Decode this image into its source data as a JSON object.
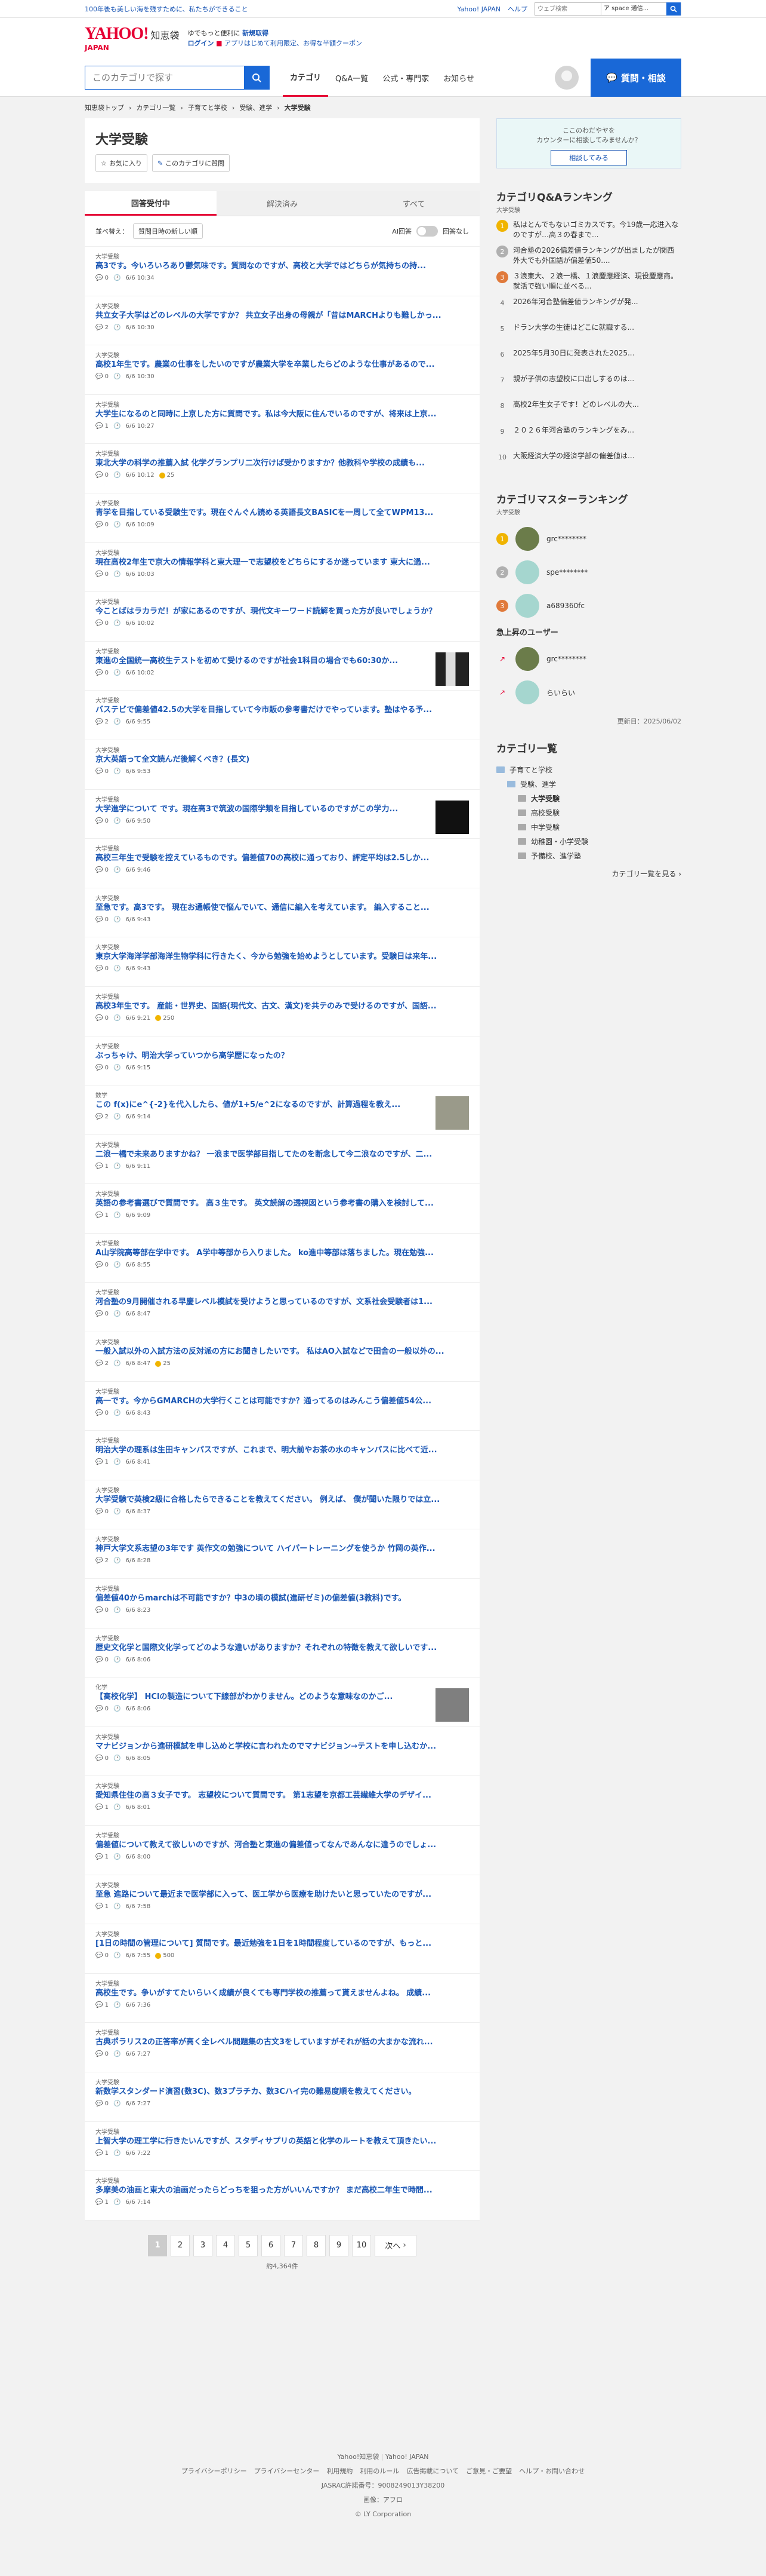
{
  "top": {
    "message": "100年後も美しい海を残すために、私たちができること",
    "links": [
      "Yahoo! JAPAN",
      "ヘルプ"
    ],
    "search_placeholder": "ウェブ検索",
    "search_select": "ア space 通信..."
  },
  "header": {
    "logo": "YAHOO!",
    "logo_sub": "知恵袋",
    "logo_japan": "JAPAN",
    "line1_pre": "ゆでもっと便利に",
    "line1_link": "新規取得",
    "line2_link": "ログイン",
    "line2_rest": "アプリはじめて利用限定、お得な半額クーポン"
  },
  "nav": {
    "search_placeholder": "このカテゴリで探す",
    "tabs": [
      "カテゴリ",
      "Q&A一覧",
      "公式・専門家",
      "お知らせ"
    ],
    "ask_button": "質問・相談"
  },
  "breadcrumb": [
    "知恵袋トップ",
    "カテゴリ一覧",
    "子育てと学校",
    "受験、進学",
    "大学受験"
  ],
  "category": {
    "title": "大学受験",
    "fav_btn": "お気に入り",
    "about_btn": "このカテゴリに質問"
  },
  "filter": {
    "tabs": [
      "回答受付中",
      "解決済み",
      "すべて"
    ],
    "option1": "並べ替え：",
    "option2": "質問日時の新しい順",
    "option3": "AI回答",
    "option4": "回答なし"
  },
  "questions": [
    {
      "cat": "大学受験",
      "title": "高3です。今いろいろあり鬱気味です。質問なのですが、高校と大学ではどちらが気持ちの持...",
      "ans": "0",
      "date": "6/6 10:34"
    },
    {
      "cat": "大学受験",
      "title": "共立女子大学はどのレベルの大学ですか？ 共立女子出身の母親が「昔はMARCHよりも難しかっ...",
      "ans": "2",
      "date": "6/6 10:30"
    },
    {
      "cat": "大学受験",
      "title": "高校1年生です。農業の仕事をしたいのですが農業大学を卒業したらどのような仕事があるので...",
      "ans": "0",
      "date": "6/6 10:30"
    },
    {
      "cat": "大学受験",
      "title": "大学生になるのと同時に上京した方に質問です。私は今大阪に住んでいるのですが、将来は上京...",
      "ans": "1",
      "date": "6/6 10:27"
    },
    {
      "cat": "大学受験",
      "title": "東北大学の科学の推薦入試 化学グランプリ二次行けば受かりますか？他教科や学校の成績も...",
      "ans": "0",
      "date": "6/6 10:12",
      "coin": "25"
    },
    {
      "cat": "大学受験",
      "title": "青学を目指している受験生です。現在ぐんぐん読める英語長文BASICを一周して全てWPM13...",
      "ans": "0",
      "date": "6/6 10:09"
    },
    {
      "cat": "大学受験",
      "title": "現在高校2年生で京大の情報学科と東大理一で志望校をどちらにするか迷っています 東大に過...",
      "ans": "0",
      "date": "6/6 10:03"
    },
    {
      "cat": "大学受験",
      "title": "今ことばはラカラだ！が家にあるのですが、現代文キーワード読解を買った方が良いでしょうか？",
      "ans": "0",
      "date": "6/6 10:02"
    },
    {
      "cat": "大学受験",
      "title": "東進の全国統一高校生テストを初めて受けるのですが社会1科目の場合でも60:30か...",
      "ans": "0",
      "date": "6/6 10:02",
      "thumb": "dark"
    },
    {
      "cat": "大学受験",
      "title": "バステビで偏差値42.5の大学を目指していて今市販の参考書だけでやっています。塾はやる予...",
      "ans": "2",
      "date": "6/6 9:55"
    },
    {
      "cat": "大学受験",
      "title": "京大英語って全文読んだ後解くべき？(長文)",
      "ans": "0",
      "date": "6/6 9:53"
    },
    {
      "cat": "大学受験",
      "title": "大学進学について です。現在高3で筑波の国際学類を目指しているのですがこの学力...",
      "ans": "0",
      "date": "6/6 9:50",
      "thumb": "black"
    },
    {
      "cat": "大学受験",
      "title": "高校三年生で受験を控えているものです。偏差値70の高校に通っており、評定平均は2.5しか...",
      "ans": "0",
      "date": "6/6 9:46"
    },
    {
      "cat": "大学受験",
      "title": "至急です。高3です。 現在お通帳使で悩んでいて、通信に編入を考えています。 編入すること...",
      "ans": "0",
      "date": "6/6 9:43"
    },
    {
      "cat": "大学受験",
      "title": "東京大学海洋学部海洋生物学科に行きたく、今から勉強を始めようとしています。受験日は来年...",
      "ans": "0",
      "date": "6/6 9:43"
    },
    {
      "cat": "大学受験",
      "title": "高校3年生です。 産能・世界史、国語(現代文、古文、漢文)を共テのみで受けるのですが、国語...",
      "ans": "0",
      "date": "6/6 9:21",
      "coin": "250"
    },
    {
      "cat": "大学受験",
      "title": "ぶっちゃけ、明治大学っていつから高学歴になったの？",
      "ans": "0",
      "date": "6/6 9:15"
    },
    {
      "cat": "数学",
      "title": "この f(x)にe^{-2}を代入したら、値が1+5/e^2になるのですが、計算過程を教え...",
      "ans": "2",
      "date": "6/6 9:14",
      "thumb": "photo"
    },
    {
      "cat": "大学受験",
      "title": "二浪一橋で未来ありますかね？ 一浪まで医学部目指してたのを断念して今二浪なのですが、二...",
      "ans": "1",
      "date": "6/6 9:11"
    },
    {
      "cat": "大学受験",
      "title": "英語の参考書選びで質問です。 高３生です。 英文読解の透視図という参考書の購入を検討して...",
      "ans": "1",
      "date": "6/6 9:09"
    },
    {
      "cat": "大学受験",
      "title": "A山学院高等部在学中です。 A学中等部から入りました。 ko進中等部は落ちました。現在勉強...",
      "ans": "0",
      "date": "6/6 8:55"
    },
    {
      "cat": "大学受験",
      "title": "河合塾の9月開催される早慶レベル模試を受けようと思っているのですが、文系社会受験者は1...",
      "ans": "0",
      "date": "6/6 8:47"
    },
    {
      "cat": "大学受験",
      "title": "一般入試以外の入試方法の反対派の方にお聞きしたいです。 私はAO入試などで田舎の一般以外の...",
      "ans": "2",
      "date": "6/6 8:47",
      "coin": "25"
    },
    {
      "cat": "大学受験",
      "title": "高一です。今からGMARCHの大学行くことは可能ですか？通ってるのはみんこう偏差値54公...",
      "ans": "0",
      "date": "6/6 8:43"
    },
    {
      "cat": "大学受験",
      "title": "明治大学の理系は生田キャンパスですが、これまで、明大前やお茶の水のキャンパスに比べて近...",
      "ans": "1",
      "date": "6/6 8:41"
    },
    {
      "cat": "大学受験",
      "title": "大学受験で英検2級に合格したらできることを教えてください。 例えば、 僕が聞いた限りでは立...",
      "ans": "0",
      "date": "6/6 8:37"
    },
    {
      "cat": "大学受験",
      "title": "神戸大学文系志望の3年です 英作文の勉強について ハイパートレーニングを使うか 竹岡の英作...",
      "ans": "2",
      "date": "6/6 8:28"
    },
    {
      "cat": "大学受験",
      "title": "偏差値40からmarchは不可能ですか？中3の頃の模試(進研ゼミ)の偏差値(3教科)です。",
      "ans": "0",
      "date": "6/6 8:23"
    },
    {
      "cat": "大学受験",
      "title": "歴史文化学と国際文化学ってどのような違いがありますか？それぞれの特徴を教えて欲しいです...",
      "ans": "0",
      "date": "6/6 8:06"
    },
    {
      "cat": "化学",
      "title": "【高校化学】 HClの製造について下線部がわかりません。どのような意味なのかご...",
      "ans": "0",
      "date": "6/6 8:06",
      "thumb": "photo2"
    },
    {
      "cat": "大学受験",
      "title": "マナビジョンから進研模試を申し込めと学校に言われたのでマナビジョン→テストを申し込むか...",
      "ans": "0",
      "date": "6/6 8:05"
    },
    {
      "cat": "大学受験",
      "title": "愛知県住住の高３女子です。 志望校について質問です。 第1志望を京都工芸繊維大学のデザイ...",
      "ans": "1",
      "date": "6/6 8:01"
    },
    {
      "cat": "大学受験",
      "title": "偏差値について教えて欲しいのですが、河合塾と東進の偏差値ってなんであんなに違うのでしょ...",
      "ans": "1",
      "date": "6/6 8:00"
    },
    {
      "cat": "大学受験",
      "title": "至急 進路について最近まで医学部に入って、医工学から医療を助けたいと思っていたのですが...",
      "ans": "1",
      "date": "6/6 7:58"
    },
    {
      "cat": "大学受験",
      "title": "[1日の時間の管理について] 質問です。最近勉強を1日を1時間程度しているのですが、もっと...",
      "ans": "0",
      "date": "6/6 7:55",
      "coin": "500"
    },
    {
      "cat": "大学受験",
      "title": "高校生です。争いがすてたいらいく成績が良くても専門学校の推薦って貰えませんよね。 成績...",
      "ans": "1",
      "date": "6/6 7:36"
    },
    {
      "cat": "大学受験",
      "title": "古典ポラリス2の正答率が高く全レベル問題集の古文3をしていますがそれが話の大まかな流れ...",
      "ans": "0",
      "date": "6/6 7:27"
    },
    {
      "cat": "大学受験",
      "title": "新数学スタンダード演習(数3C)、数3プラチカ、数3Cハイ完の難易度順を教えてください。",
      "ans": "0",
      "date": "6/6 7:27"
    },
    {
      "cat": "大学受験",
      "title": "上智大学の理工学に行きたいんですが、スタディサプリの英語と化学のルートを教えて頂きたい...",
      "ans": "1",
      "date": "6/6 7:22"
    },
    {
      "cat": "大学受験",
      "title": "多摩美の油画と東大の油画だったらどっちを狙った方がいいんですか？ まだ高校二年生で時間...",
      "ans": "1",
      "date": "6/6 7:14"
    }
  ],
  "pager": {
    "pages": [
      "1",
      "2",
      "3",
      "4",
      "5",
      "6",
      "7",
      "8",
      "9",
      "10"
    ],
    "next": "次へ",
    "total": "約4,364件"
  },
  "ad": {
    "line1": "ここのわだやヤを",
    "line2": "カウンターに相談してみませんか？",
    "button": "相談してみる"
  },
  "ranking": {
    "title": "カテゴリQ&Aランキング",
    "sub": "大学受験",
    "items": [
      "私はとんでもないゴミカスです。今19歳一応进入なのですが…高３の春まで...",
      "河合塾の2026偏差値ランキングが出ましたが関西外大でも外国語が偏差値50....",
      "３浪東大、２浪一橋、１浪慶應経済、現役慶應商。就活で強い順に並べる...",
      "2026年河合塾偏差値ランキングが発...",
      "ドラン大学の生徒はどこに就職する...",
      "2025年5月30日に発表された2025...",
      "親が子供の志望校に口出しするのは...",
      "高校2年生女子です！どのレベルの大...",
      "２０２６年河合塾のランキングをみ...",
      "大阪経済大学の経済学部の偏差値は..."
    ]
  },
  "master": {
    "title": "カテゴリマスターランキング",
    "sub": "大学受験",
    "users": [
      "grc********",
      "spe********",
      "a689360fc"
    ],
    "rise_title": "急上昇のユーザー",
    "rise_users": [
      "grc********",
      "らいらい"
    ],
    "updated": "更新日：2025/06/02"
  },
  "catlist": {
    "title": "カテゴリ一覧",
    "items": [
      "子育てと学校",
      "受験、進学",
      "大学受験",
      "高校受験",
      "中学受験",
      "幼稚園・小学受験",
      "予備校、進学塾"
    ],
    "more": "カテゴリ一覧を見る"
  },
  "footer": {
    "top_links": [
      "Yahoo!知恵袋",
      "Yahoo! JAPAN"
    ],
    "links": [
      "プライバシーポリシー",
      "プライバシーセンター",
      "利用規約",
      "利用のルール",
      "広告掲載について",
      "ご意見・ご要望",
      "ヘルプ・お問い合わせ"
    ],
    "code": "JASRAC許諾番号：9008249013Y38200",
    "notice": "画像：アフロ",
    "copyright": "© LY Corporation"
  }
}
